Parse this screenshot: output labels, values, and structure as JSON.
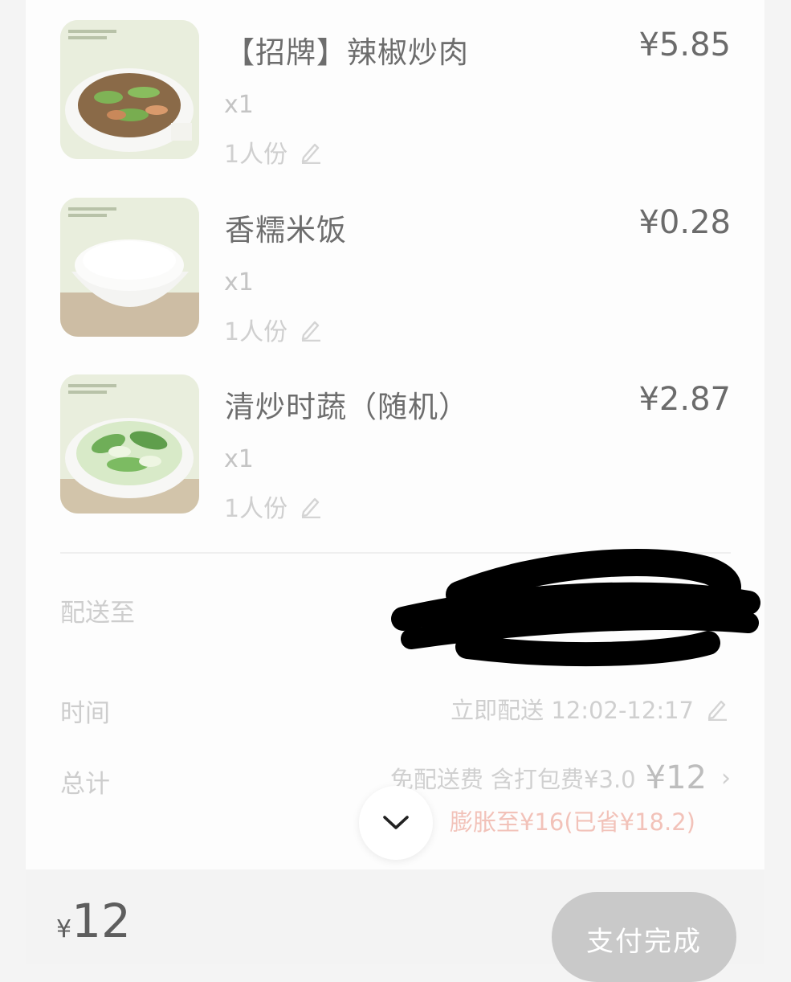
{
  "items": [
    {
      "name": "【招牌】辣椒炒肉",
      "price": "¥5.85",
      "qty": "x1",
      "spec": "1人份",
      "image_icon": "pepper-pork-dish-icon"
    },
    {
      "name": "香糯米饭",
      "price": "¥0.28",
      "qty": "x1",
      "spec": "1人份",
      "image_icon": "rice-bowl-icon"
    },
    {
      "name": "清炒时蔬（随机）",
      "price": "¥2.87",
      "qty": "x1",
      "spec": "1人份",
      "image_icon": "greens-dish-icon"
    }
  ],
  "delivery": {
    "label": "配送至"
  },
  "time": {
    "label": "时间",
    "value": "立即配送 12:02-12:17"
  },
  "total": {
    "label": "总计",
    "fees": "免配送费 含打包费¥3.0",
    "amount": "¥12",
    "promo": "膨胀至¥16(已省¥18.2)"
  },
  "bottom": {
    "currency": "¥",
    "amount": "12",
    "pay_label": "支付完成"
  },
  "colors": {
    "accent_promo": "#f2c2b9",
    "pay_button_bg": "#c9c9c9"
  }
}
